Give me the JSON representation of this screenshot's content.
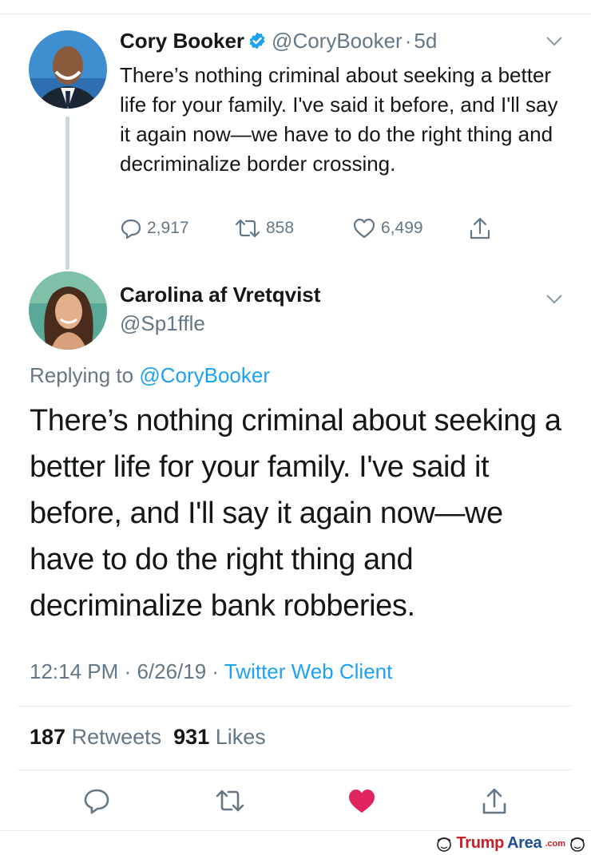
{
  "tweet1": {
    "name": "Cory Booker",
    "handle": "@CoryBooker",
    "separator": "·",
    "time": "5d",
    "text": "There’s nothing criminal about seeking a better life for your family. I've said it before, and I'll say it again now—we have to do the right thing and decriminalize border crossing.",
    "replies": "2,917",
    "retweets": "858",
    "likes": "6,499"
  },
  "tweet2": {
    "name": "Carolina af Vretqvist",
    "handle": "@Sp1ffle",
    "replying_prefix": "Replying to ",
    "replying_to": "@CoryBooker",
    "text": "There’s nothing criminal about seeking a better life for your family. I've said it before, and I'll say it again now—we have to do the right thing and decriminalize bank robberies.",
    "time": "12:14 PM",
    "date": "6/26/19",
    "separator": "·",
    "client": "Twitter Web Client",
    "retweet_count": "187",
    "retweet_label": "Retweets",
    "like_count": "931",
    "like_label": "Likes"
  },
  "watermark": {
    "brand_a": "Trump",
    "brand_b": "Area",
    "brand_c": ".com"
  },
  "colors": {
    "accent": "#1da1f2",
    "like_red": "#e0245e",
    "muted": "#657786",
    "text": "#14171a"
  },
  "icons": [
    "verified-icon",
    "chevron-down-icon",
    "reply-icon",
    "retweet-icon",
    "like-icon",
    "share-icon"
  ]
}
